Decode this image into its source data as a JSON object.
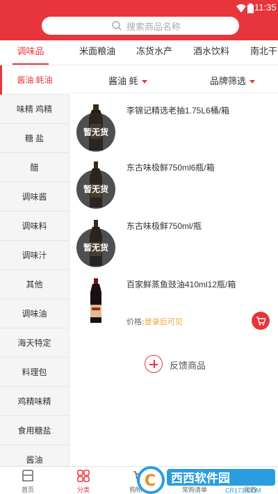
{
  "status": {
    "time": "11:35"
  },
  "search": {
    "placeholder": "搜索商品名称"
  },
  "tabs": [
    "调味品",
    "米面粮油",
    "冻货水产",
    "酒水饮料",
    "南北干货"
  ],
  "sidebar": [
    "酱油 蚝油",
    "味精 鸡精",
    "糖 盐",
    "醋",
    "调味酱",
    "调味料",
    "调味汁",
    "其他",
    "调味油",
    "海天特定",
    "料理包",
    "鸡精味精",
    "食用糖盐",
    "酱油"
  ],
  "filters": {
    "category": "酱油 蚝",
    "brand": "品牌筛选"
  },
  "products": [
    {
      "name": "李锦记精选老抽1.75L6桶/箱",
      "badge": "暂无货"
    },
    {
      "name": "东古味极鲜750ml6瓶/箱",
      "badge": "暂无货"
    },
    {
      "name": "东古味极鲜750ml/瓶",
      "badge": "暂无货"
    },
    {
      "name": "百家鲜蒸鱼豉油410ml12瓶/箱",
      "price_label": "价格:",
      "price_link": "登录后可见"
    }
  ],
  "feedback": {
    "label": "反馈商品"
  },
  "bottom_nav": [
    "首页",
    "分类",
    "购物车",
    "常购清单",
    "我的"
  ],
  "watermark": {
    "text": "西西软件园",
    "url": "CR173.COM"
  },
  "colors": {
    "brand": "#e8353c",
    "price_link": "#f0a030"
  }
}
